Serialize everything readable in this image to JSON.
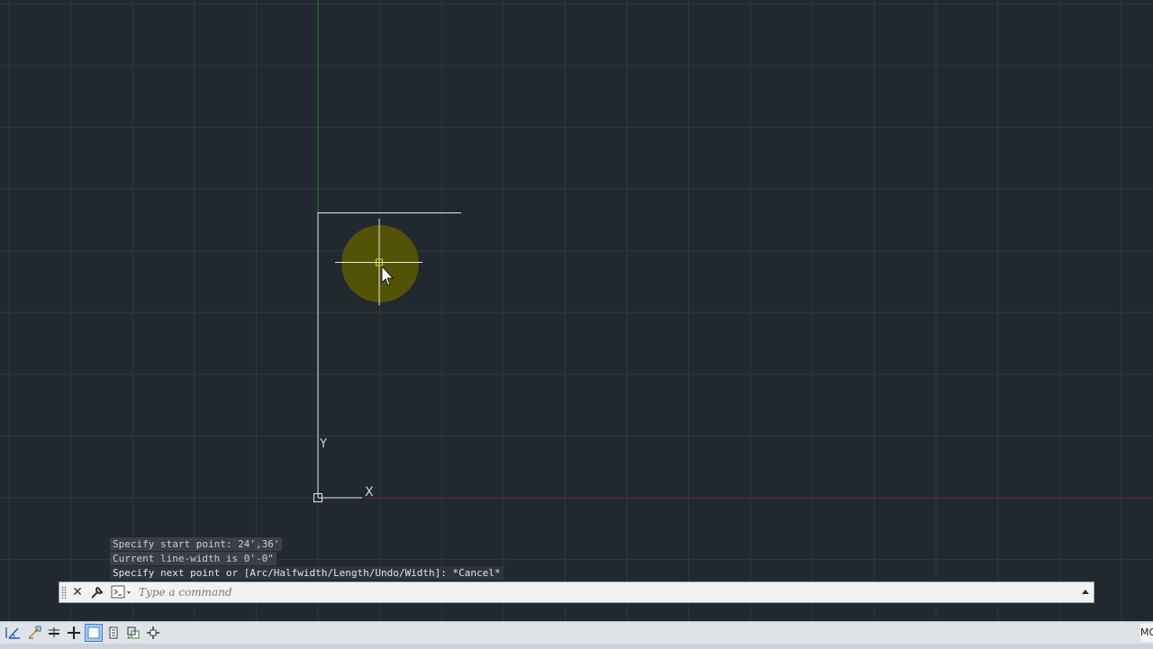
{
  "history": [
    "Specify start point: 24',36'",
    "Current line-width is 0'-0\"",
    "Specify next point or [Arc/Halfwidth/Length/Undo/Width]: *Cancel*"
  ],
  "command_line": {
    "placeholder": "Type a command",
    "close_icon": "close-icon",
    "tools_icon": "wrench-icon",
    "prompt_icon": "command-prompt-icon"
  },
  "ucs": {
    "y_label": "Y",
    "x_label": "X"
  },
  "status_bar": {
    "tools": [
      "polar-tracking-icon",
      "object-snap-tracking-icon",
      "lineweight-icon",
      "dynamic-input-icon",
      "transparency-icon",
      "quick-properties-icon",
      "selection-cycling-icon",
      "annotation-monitor-icon"
    ],
    "right_label": "MO"
  },
  "colors": {
    "canvas": "#212830",
    "grid": "#2e3843",
    "y_axis": "#2f7a3a",
    "x_axis": "#7a2f2f",
    "crosshair_halo": "#5a5a00",
    "pickbox": "#e0e000"
  }
}
